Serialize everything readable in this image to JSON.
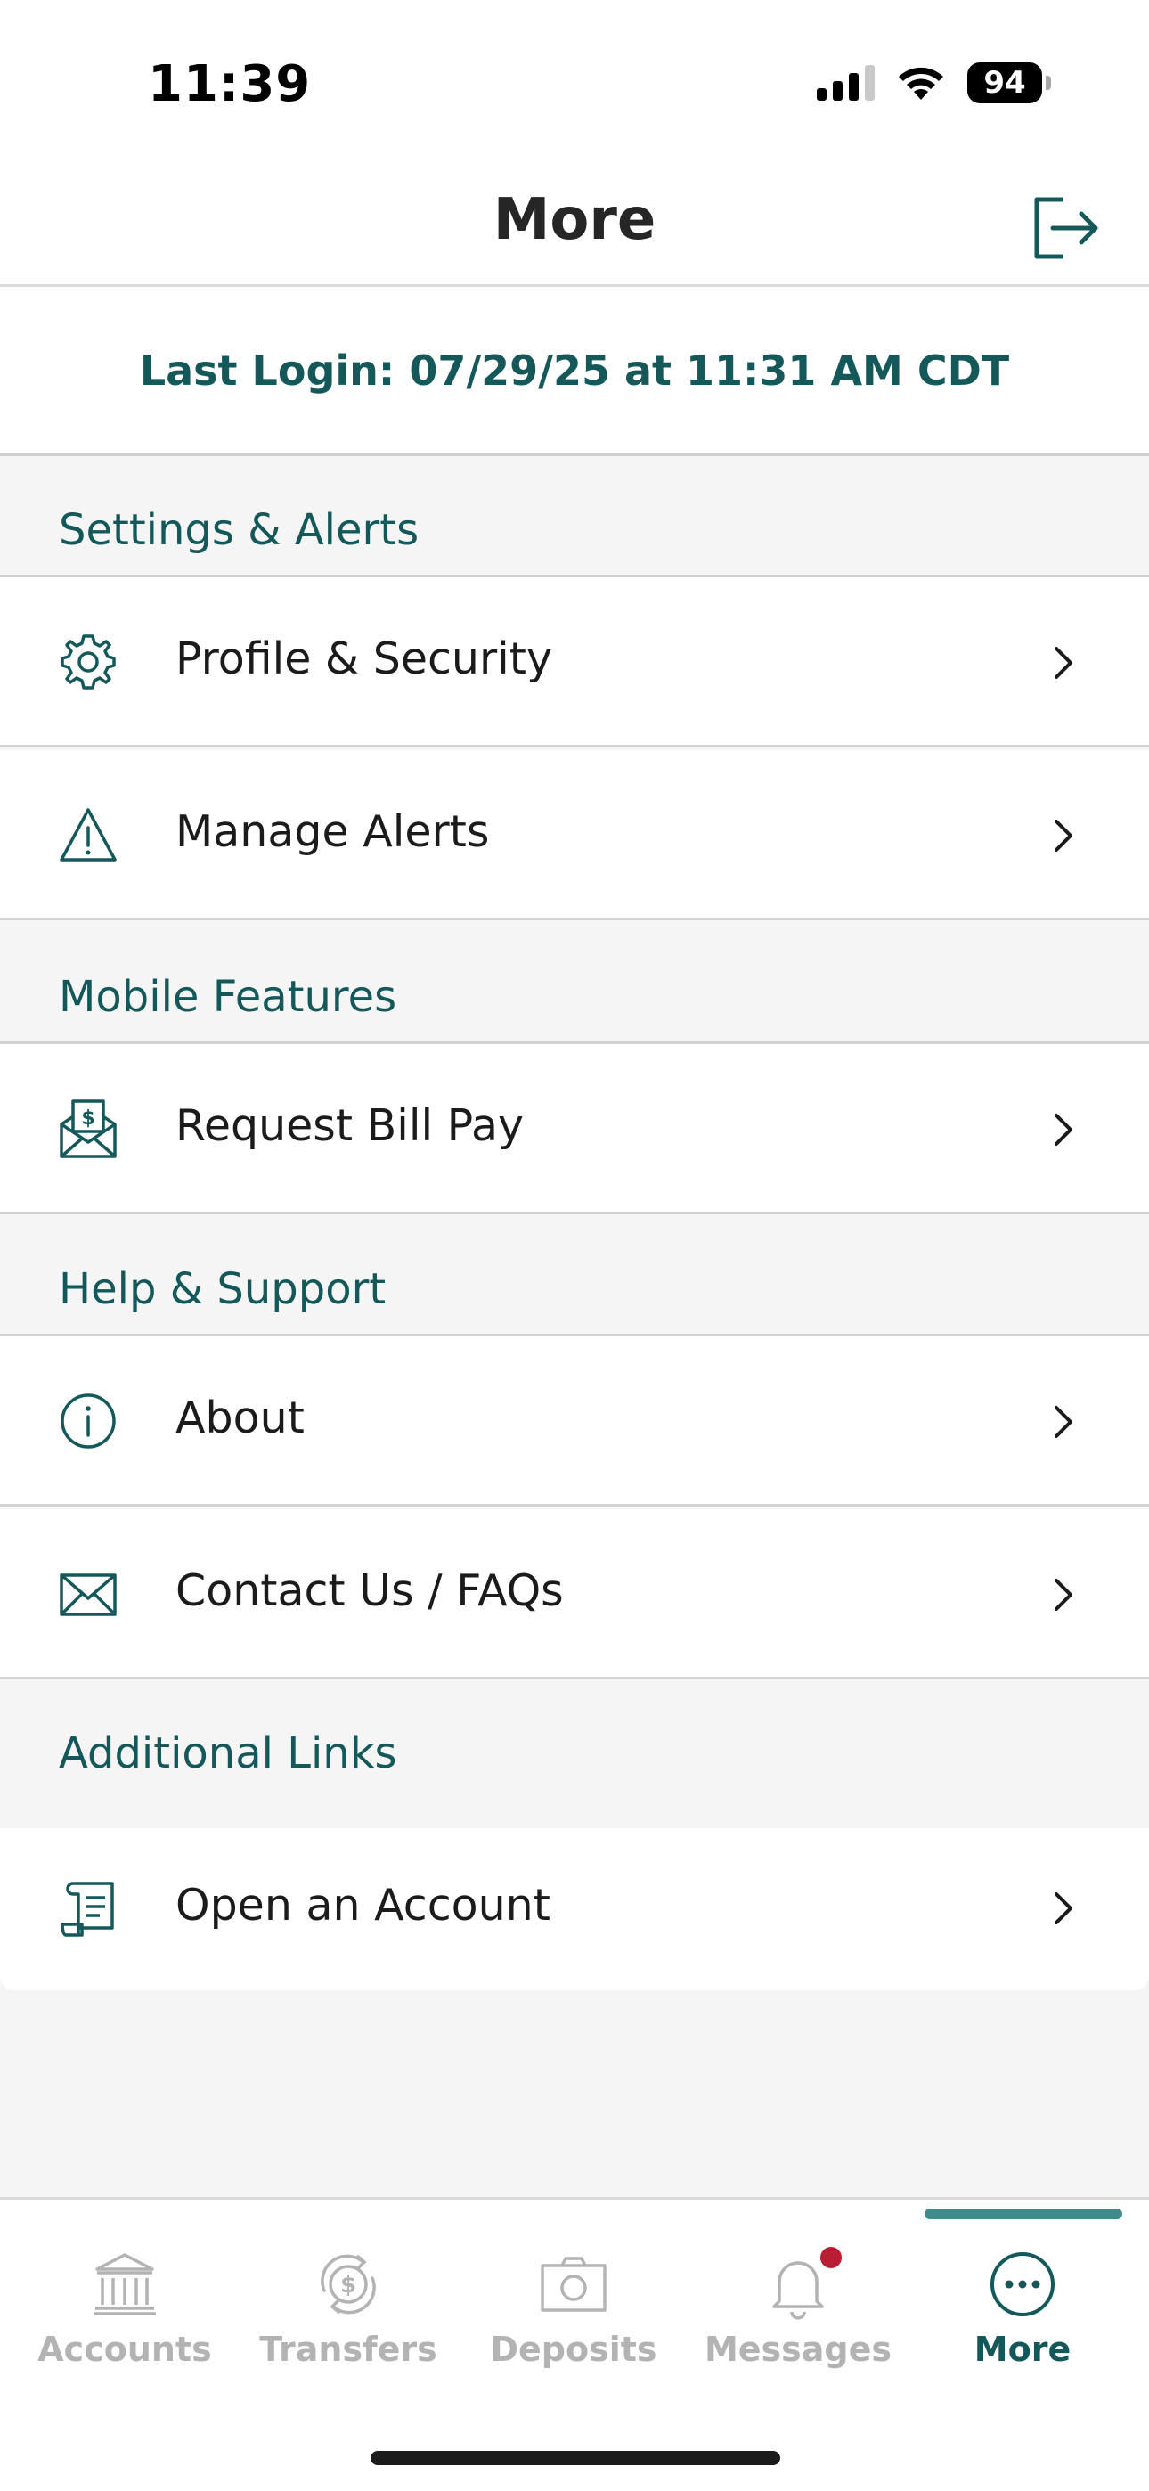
{
  "status": {
    "time": "11:39",
    "battery": "94"
  },
  "header": {
    "title": "More",
    "logout_icon": "logout-icon"
  },
  "last_login": "Last Login: 07/29/25 at 11:31 AM CDT",
  "sections": [
    {
      "title": "Settings & Alerts",
      "items": [
        {
          "label": "Profile & Security",
          "icon": "gear-icon"
        },
        {
          "label": "Manage Alerts",
          "icon": "warning-icon"
        }
      ]
    },
    {
      "title": "Mobile Features",
      "items": [
        {
          "label": "Request Bill Pay",
          "icon": "bill-envelope-icon"
        }
      ]
    },
    {
      "title": "Help & Support",
      "items": [
        {
          "label": "About",
          "icon": "info-icon"
        },
        {
          "label": "Contact Us / FAQs",
          "icon": "mail-icon"
        }
      ]
    },
    {
      "title": "Additional Links",
      "items": [
        {
          "label": "Open an Account",
          "icon": "document-icon"
        }
      ]
    }
  ],
  "tabs": [
    {
      "label": "Accounts",
      "icon": "bank-icon",
      "active": false
    },
    {
      "label": "Transfers",
      "icon": "transfer-dollar-icon",
      "active": false
    },
    {
      "label": "Deposits",
      "icon": "camera-icon",
      "active": false
    },
    {
      "label": "Messages",
      "icon": "bell-icon",
      "active": false,
      "badge": true
    },
    {
      "label": "More",
      "icon": "more-dots-icon",
      "active": true
    }
  ],
  "colors": {
    "accent": "#15585a",
    "inactive": "#b3b3b3",
    "badge": "#b81f35",
    "background": "#f5f5f5"
  }
}
